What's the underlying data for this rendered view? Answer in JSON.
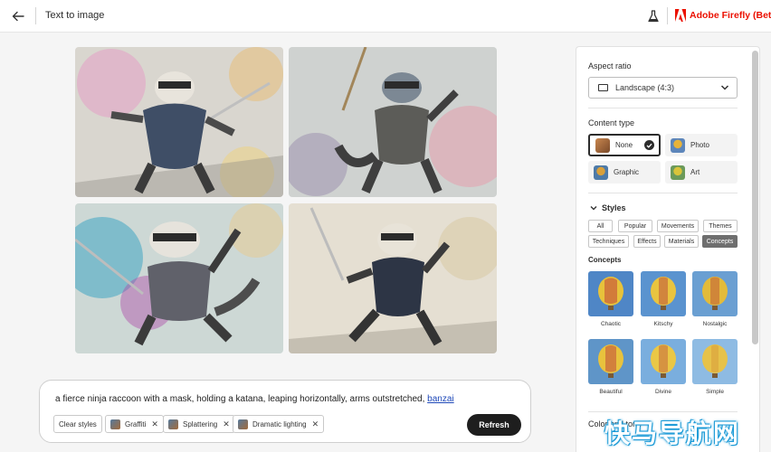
{
  "header": {
    "title": "Text to image",
    "brand": "Adobe Firefly (Beta)"
  },
  "gallery": {
    "images": [
      {
        "alt": "ninja raccoon 1"
      },
      {
        "alt": "ninja raccoon 2"
      },
      {
        "alt": "ninja raccoon 3"
      },
      {
        "alt": "ninja raccoon 4"
      }
    ]
  },
  "prompt": {
    "text": "a fierce ninja raccoon with a mask, holding a katana, leaping horizontally, arms outstretched, ",
    "link_word": "banzai",
    "clear_label": "Clear styles",
    "chips": [
      {
        "label": "Graffiti"
      },
      {
        "label": "Splattering"
      },
      {
        "label": "Dramatic lighting"
      }
    ],
    "refresh_label": "Refresh"
  },
  "panel": {
    "aspect_ratio_heading": "Aspect ratio",
    "aspect_ratio_value": "Landscape (4:3)",
    "content_type_heading": "Content type",
    "content_types": [
      {
        "label": "None",
        "selected": true
      },
      {
        "label": "Photo",
        "selected": false
      },
      {
        "label": "Graphic",
        "selected": false
      },
      {
        "label": "Art",
        "selected": false
      }
    ],
    "styles_heading": "Styles",
    "style_tabs": [
      {
        "label": "All"
      },
      {
        "label": "Popular"
      },
      {
        "label": "Movements"
      },
      {
        "label": "Themes"
      },
      {
        "label": "Techniques"
      },
      {
        "label": "Effects"
      },
      {
        "label": "Materials"
      },
      {
        "label": "Concepts",
        "active": true
      }
    ],
    "concepts_heading": "Concepts",
    "concepts": [
      {
        "label": "Chaotic"
      },
      {
        "label": "Kitschy"
      },
      {
        "label": "Nostalgic"
      },
      {
        "label": "Beautiful"
      },
      {
        "label": "Divine"
      },
      {
        "label": "Simple"
      }
    ],
    "color_heading": "Color and tone"
  },
  "watermark": "快马导航网",
  "colors": {
    "brand": "#eb1000",
    "link": "#1f49b9",
    "refresh_bg": "#1e1e1e",
    "active_tag": "#6e6e6e"
  }
}
